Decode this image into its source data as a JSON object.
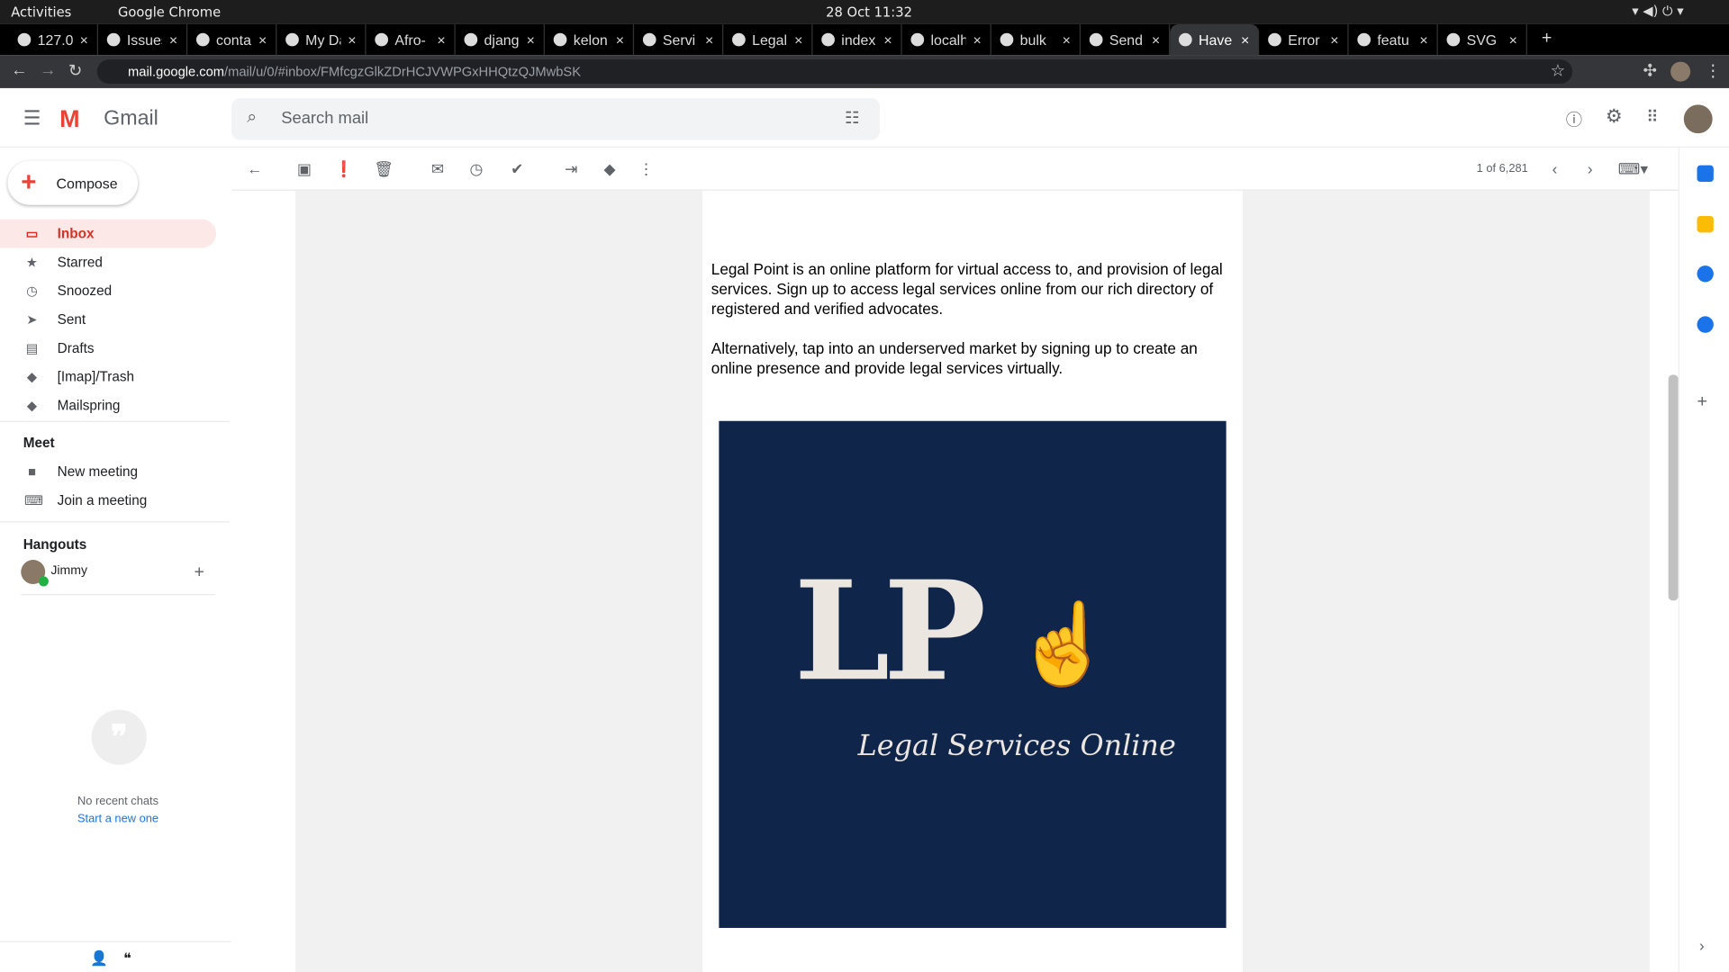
{
  "os": {
    "activities": "Activities",
    "app": "Google Chrome",
    "clock": "28 Oct  11:32"
  },
  "tabs": [
    {
      "title": "127.0.",
      "icon": "globe-icon"
    },
    {
      "title": "Issues",
      "icon": "gitlab-icon"
    },
    {
      "title": "conta",
      "icon": "globe-icon"
    },
    {
      "title": "My Da",
      "icon": "lp-icon"
    },
    {
      "title": "Afro-",
      "icon": "github-icon"
    },
    {
      "title": "djang",
      "icon": "stackoverflow-icon"
    },
    {
      "title": "kelon",
      "icon": "github-icon"
    },
    {
      "title": "Servi",
      "icon": "arrow-icon"
    },
    {
      "title": "Legal",
      "icon": "lp-icon"
    },
    {
      "title": "index",
      "icon": "globe-icon"
    },
    {
      "title": "localh",
      "icon": "globe-icon"
    },
    {
      "title": "bulk",
      "icon": "duckduckgo-icon"
    },
    {
      "title": "Send",
      "icon": "django-icon"
    },
    {
      "title": "Have",
      "icon": "gmail-icon",
      "active": true
    },
    {
      "title": "Error",
      "icon": "pinwheel-icon"
    },
    {
      "title": "featu",
      "icon": "globe-icon"
    },
    {
      "title": "SVG",
      "icon": "svg-icon"
    }
  ],
  "address": {
    "host": "mail.google.com",
    "path": "/mail/u/0/#inbox/FMfcgzGlkZDrHCJVWPGxHHQtzQJMwbSK"
  },
  "gmail": {
    "logo": "Gmail",
    "search_placeholder": "Search mail",
    "compose": "Compose",
    "nav": [
      {
        "label": "Inbox",
        "icon": "inbox-icon",
        "selected": true
      },
      {
        "label": "Starred",
        "icon": "star-icon"
      },
      {
        "label": "Snoozed",
        "icon": "clock-icon"
      },
      {
        "label": "Sent",
        "icon": "send-icon"
      },
      {
        "label": "Drafts",
        "icon": "draft-icon"
      },
      {
        "label": "[Imap]/Trash",
        "icon": "label-icon"
      },
      {
        "label": "Mailspring",
        "icon": "label-icon"
      }
    ],
    "meet": {
      "heading": "Meet",
      "new": "New meeting",
      "join": "Join a meeting"
    },
    "hangouts": {
      "heading": "Hangouts",
      "user": "Jimmy",
      "no_chats": "No recent chats",
      "start": "Start a new one"
    },
    "pager": "1 of 6,281"
  },
  "email": {
    "p1": "Legal Point is an online platform for virtual access to, and provision of legal services. Sign up to access legal services online from our rich directory of registered and verified advocates.",
    "p2": "Alternatively, tap into an underserved market by signing up to create an online presence and provide legal services virtually.",
    "logo_letters": "LP",
    "logo_tagline": "Legal Services Online",
    "logo_bg": "#0f2549"
  }
}
